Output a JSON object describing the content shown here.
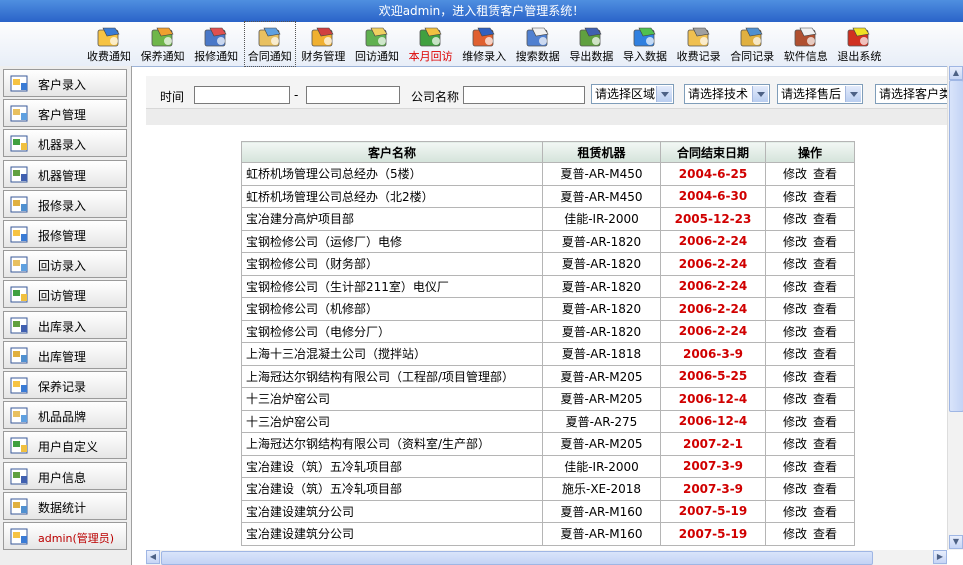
{
  "window": {
    "title": "欢迎admin，进入租赁客户管理系统！"
  },
  "toolbar": [
    {
      "label": "收费通知",
      "icon": "notice-bell-icon",
      "name": "tool-fee-notice"
    },
    {
      "label": "保养通知",
      "icon": "photo-card-icon",
      "name": "tool-maintenance-notice"
    },
    {
      "label": "报修通知",
      "icon": "brush-tools-icon",
      "name": "tool-repair-notice"
    },
    {
      "label": "合同通知",
      "icon": "contract-grid-icon",
      "name": "tool-contract-notice"
    },
    {
      "label": "财务管理",
      "icon": "envelope-folder-icon",
      "name": "tool-finance"
    },
    {
      "label": "回访通知",
      "icon": "return-visit-icon",
      "name": "tool-visit-notice"
    },
    {
      "label": "本月回访",
      "icon": "green-arrow-up-icon",
      "name": "tool-monthly-visit"
    },
    {
      "label": "维修录入",
      "icon": "clock-pen-icon",
      "name": "tool-repair-entry"
    },
    {
      "label": "搜索数据",
      "icon": "search-document-icon",
      "name": "tool-search-data"
    },
    {
      "label": "导出数据",
      "icon": "export-user-icon",
      "name": "tool-export-data"
    },
    {
      "label": "导入数据",
      "icon": "globe-import-icon",
      "name": "tool-import-data"
    },
    {
      "label": "收费记录",
      "icon": "fee-record-icon",
      "name": "tool-fee-record"
    },
    {
      "label": "合同记录",
      "icon": "contract-record-icon",
      "name": "tool-contract-record"
    },
    {
      "label": "软件信息",
      "icon": "home-icon",
      "name": "tool-software-info"
    },
    {
      "label": "退出系统",
      "icon": "exit-sign-icon",
      "name": "tool-exit"
    }
  ],
  "sidebar": [
    {
      "label": "客户录入",
      "icon": "customer-entry-icon",
      "name": "sidebar-item-customer-entry"
    },
    {
      "label": "客户管理",
      "icon": "customer-manage-icon",
      "name": "sidebar-item-customer-manage"
    },
    {
      "label": "机器录入",
      "icon": "text-tool-icon",
      "name": "sidebar-item-machine-entry"
    },
    {
      "label": "机器管理",
      "icon": "letter-a-icon",
      "name": "sidebar-item-machine-manage"
    },
    {
      "label": "报修录入",
      "icon": "checklist-icon",
      "name": "sidebar-item-repair-entry"
    },
    {
      "label": "报修管理",
      "icon": "gear-people-icon",
      "name": "sidebar-item-repair-manage"
    },
    {
      "label": "回访录入",
      "icon": "door-icon",
      "name": "sidebar-item-visit-entry"
    },
    {
      "label": "回访管理",
      "icon": "copy-pages-icon",
      "name": "sidebar-item-visit-manage"
    },
    {
      "label": "出库录入",
      "icon": "outbound-entry-icon",
      "name": "sidebar-item-outbound-entry"
    },
    {
      "label": "出库管理",
      "icon": "tree-network-icon",
      "name": "sidebar-item-outbound-manage"
    },
    {
      "label": "保养记录",
      "icon": "book-stack-icon",
      "name": "sidebar-item-maintenance-record"
    },
    {
      "label": "机品品牌",
      "icon": "id-card-icon",
      "name": "sidebar-item-brand"
    },
    {
      "label": "用户自定义",
      "icon": "custom-settings-icon",
      "name": "sidebar-item-user-custom"
    },
    {
      "label": "用户信息",
      "icon": "user-info-icon",
      "name": "sidebar-item-user-info"
    },
    {
      "label": "数据统计",
      "icon": "statistics-icon",
      "name": "sidebar-item-statistics"
    },
    {
      "label": "admin(管理员)",
      "icon": "house-user-icon",
      "name": "sidebar-item-admin"
    }
  ],
  "filters": {
    "time_label": "时间",
    "time_from": "",
    "time_sep": "-",
    "time_to": "",
    "company_label": "公司名称",
    "company_value": "",
    "region": "请选择区域",
    "tech": "请选择技术",
    "aftersale": "请选择售后",
    "customer_type": "请选择客户类"
  },
  "table": {
    "headers": [
      "客户名称",
      "租赁机器",
      "合同结束日期",
      "操作"
    ],
    "op_edit": "修改",
    "op_view": "查看",
    "rows": [
      {
        "name": "虹桥机场管理公司总经办（5楼）",
        "machine": "夏普-AR-M450",
        "date": "2004-6-25"
      },
      {
        "name": "虹桥机场管理公司总经办（北2楼）",
        "machine": "夏普-AR-M450",
        "date": "2004-6-30"
      },
      {
        "name": "宝冶建分高炉项目部",
        "machine": "佳能-IR-2000",
        "date": "2005-12-23"
      },
      {
        "name": "宝钢检修公司（运修厂）电修",
        "machine": "夏普-AR-1820",
        "date": "2006-2-24"
      },
      {
        "name": "宝钢检修公司（财务部）",
        "machine": "夏普-AR-1820",
        "date": "2006-2-24"
      },
      {
        "name": "宝钢检修公司（生计部211室）电仪厂",
        "machine": "夏普-AR-1820",
        "date": "2006-2-24"
      },
      {
        "name": "宝钢检修公司（机修部）",
        "machine": "夏普-AR-1820",
        "date": "2006-2-24"
      },
      {
        "name": "宝钢检修公司（电修分厂）",
        "machine": "夏普-AR-1820",
        "date": "2006-2-24"
      },
      {
        "name": "上海十三冶混凝土公司（搅拌站）",
        "machine": "夏普-AR-1818",
        "date": "2006-3-9"
      },
      {
        "name": "上海冠达尔钢结构有限公司（工程部/项目管理部）",
        "machine": "夏普-AR-M205",
        "date": "2006-5-25"
      },
      {
        "name": "十三冶炉窑公司",
        "machine": "夏普-AR-M205",
        "date": "2006-12-4"
      },
      {
        "name": "十三冶炉窑公司",
        "machine": "夏普-AR-275",
        "date": "2006-12-4"
      },
      {
        "name": "上海冠达尔钢结构有限公司（资料室/生产部）",
        "machine": "夏普-AR-M205",
        "date": "2007-2-1"
      },
      {
        "name": "宝冶建设（筑）五冷轧项目部",
        "machine": "佳能-IR-2000",
        "date": "2007-3-9"
      },
      {
        "name": "宝冶建设（筑）五冷轧项目部",
        "machine": "施乐-XE-2018",
        "date": "2007-3-9"
      },
      {
        "name": "宝冶建设建筑分公司",
        "machine": "夏普-AR-M160",
        "date": "2007-5-19"
      },
      {
        "name": "宝冶建设建筑分公司",
        "machine": "夏普-AR-M160",
        "date": "2007-5-19"
      }
    ]
  },
  "colors": {
    "title_bar": "#2a63c8",
    "date_red": "#d00000",
    "header_bg": "#d4e3da"
  }
}
